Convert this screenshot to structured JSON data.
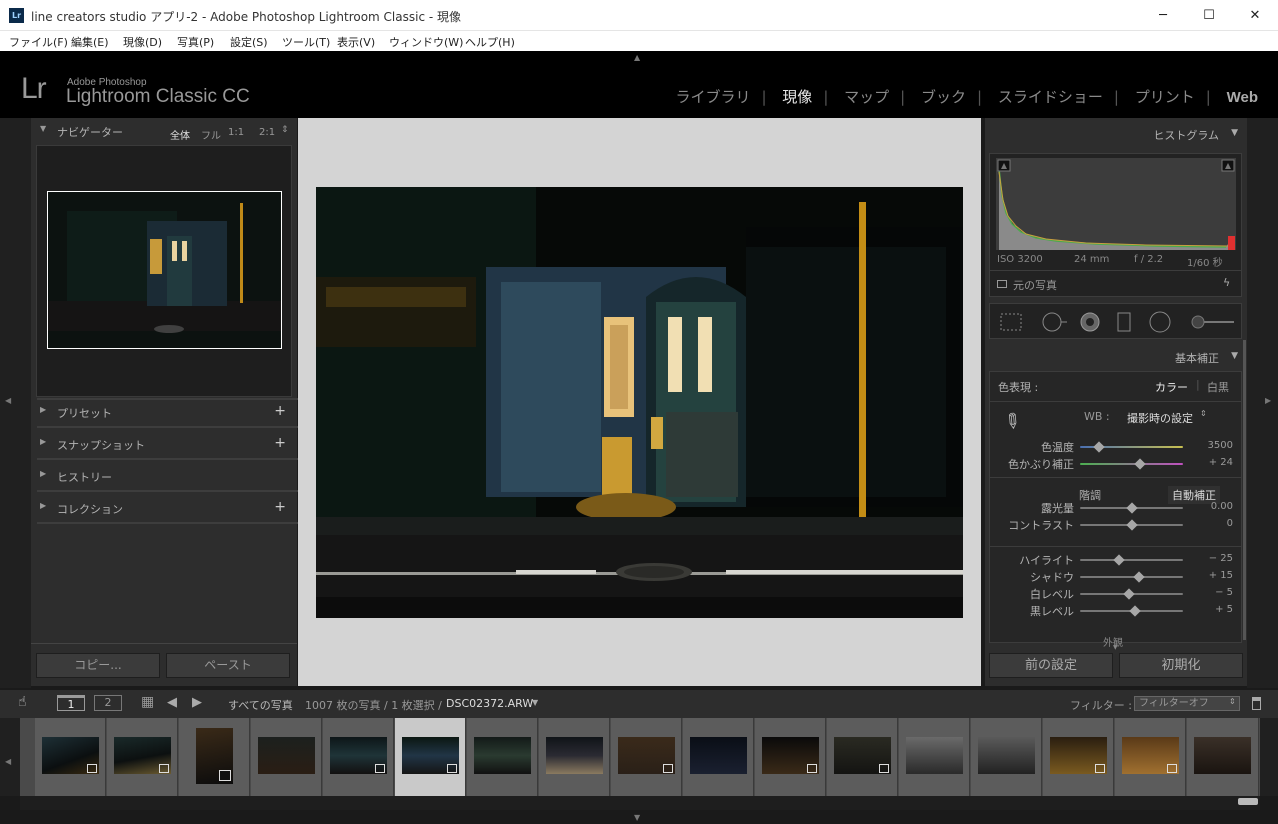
{
  "window": {
    "app_icon": "Lr",
    "title": "line creators studio アプリ-2 - Adobe Photoshop Lightroom Classic - 現像",
    "minimize": "─",
    "maximize": "☐",
    "close": "✕"
  },
  "menu": [
    "ファイル(F)",
    "編集(E)",
    "現像(D)",
    "写真(P)",
    "設定(S)",
    "ツール(T)",
    "表示(V)",
    "ウィンドウ(W)",
    "ヘルプ(H)"
  ],
  "identity": {
    "logo": "Lr",
    "brand": "Adobe Photoshop",
    "product": "Lightroom Classic CC"
  },
  "modules": [
    {
      "label": "ライブラリ",
      "active": false
    },
    {
      "label": "現像",
      "active": true
    },
    {
      "label": "マップ",
      "active": false
    },
    {
      "label": "ブック",
      "active": false
    },
    {
      "label": "スライドショー",
      "active": false
    },
    {
      "label": "プリント",
      "active": false
    },
    {
      "label": "Web",
      "active": false
    }
  ],
  "navigator": {
    "title": "ナビゲーター",
    "zoom_options": [
      "全体",
      "フル",
      "1:1",
      "2:1"
    ],
    "selected_zoom": "全体"
  },
  "left_sections": [
    {
      "label": "プリセット",
      "plus": "+"
    },
    {
      "label": "スナップショット",
      "plus": "+"
    },
    {
      "label": "ヒストリー",
      "plus": ""
    },
    {
      "label": "コレクション",
      "plus": "+"
    }
  ],
  "left_buttons": {
    "copy": "コピー...",
    "paste": "ペースト"
  },
  "histogram": {
    "title": "ヒストグラム",
    "iso": "ISO 3200",
    "focal": "24 mm",
    "aperture": "f / 2.2",
    "shutter": "1/60 秒",
    "original_photo": "元の写真"
  },
  "basic": {
    "title": "基本補正",
    "treatment_label": "色表現 :",
    "color": "カラー",
    "bw": "白黒",
    "wb_label": "WB :",
    "wb_value": "撮影時の設定",
    "temp_label": "色温度",
    "temp_value": "3500",
    "tint_label": "色かぶり補正",
    "tint_value": "+ 24",
    "tone_label": "階調",
    "auto": "自動補正",
    "sliders": [
      {
        "label": "露光量",
        "value": "0.00",
        "pos": 0.5
      },
      {
        "label": "コントラスト",
        "value": "0",
        "pos": 0.5
      },
      {
        "label": "ハイライト",
        "value": "− 25",
        "pos": 0.38
      },
      {
        "label": "シャドウ",
        "value": "+ 15",
        "pos": 0.57
      },
      {
        "label": "白レベル",
        "value": "− 5",
        "pos": 0.48
      },
      {
        "label": "黒レベル",
        "value": "+ 5",
        "pos": 0.53
      }
    ],
    "presence": "外観"
  },
  "right_buttons": {
    "previous": "前の設定",
    "reset": "初期化"
  },
  "filmstrip_bar": {
    "view1": "1",
    "view2": "2",
    "source": "すべての写真",
    "count": "1007 枚の写真 / 1 枚選択 /",
    "filename": "DSC02372.ARW",
    "filter_label": "フィルター :",
    "filter_value": "フィルターオフ"
  },
  "colors": {
    "panel": "#2d2d2d",
    "center_bg": "#d4d4d4",
    "accent_slider": "#a7a7a7"
  }
}
